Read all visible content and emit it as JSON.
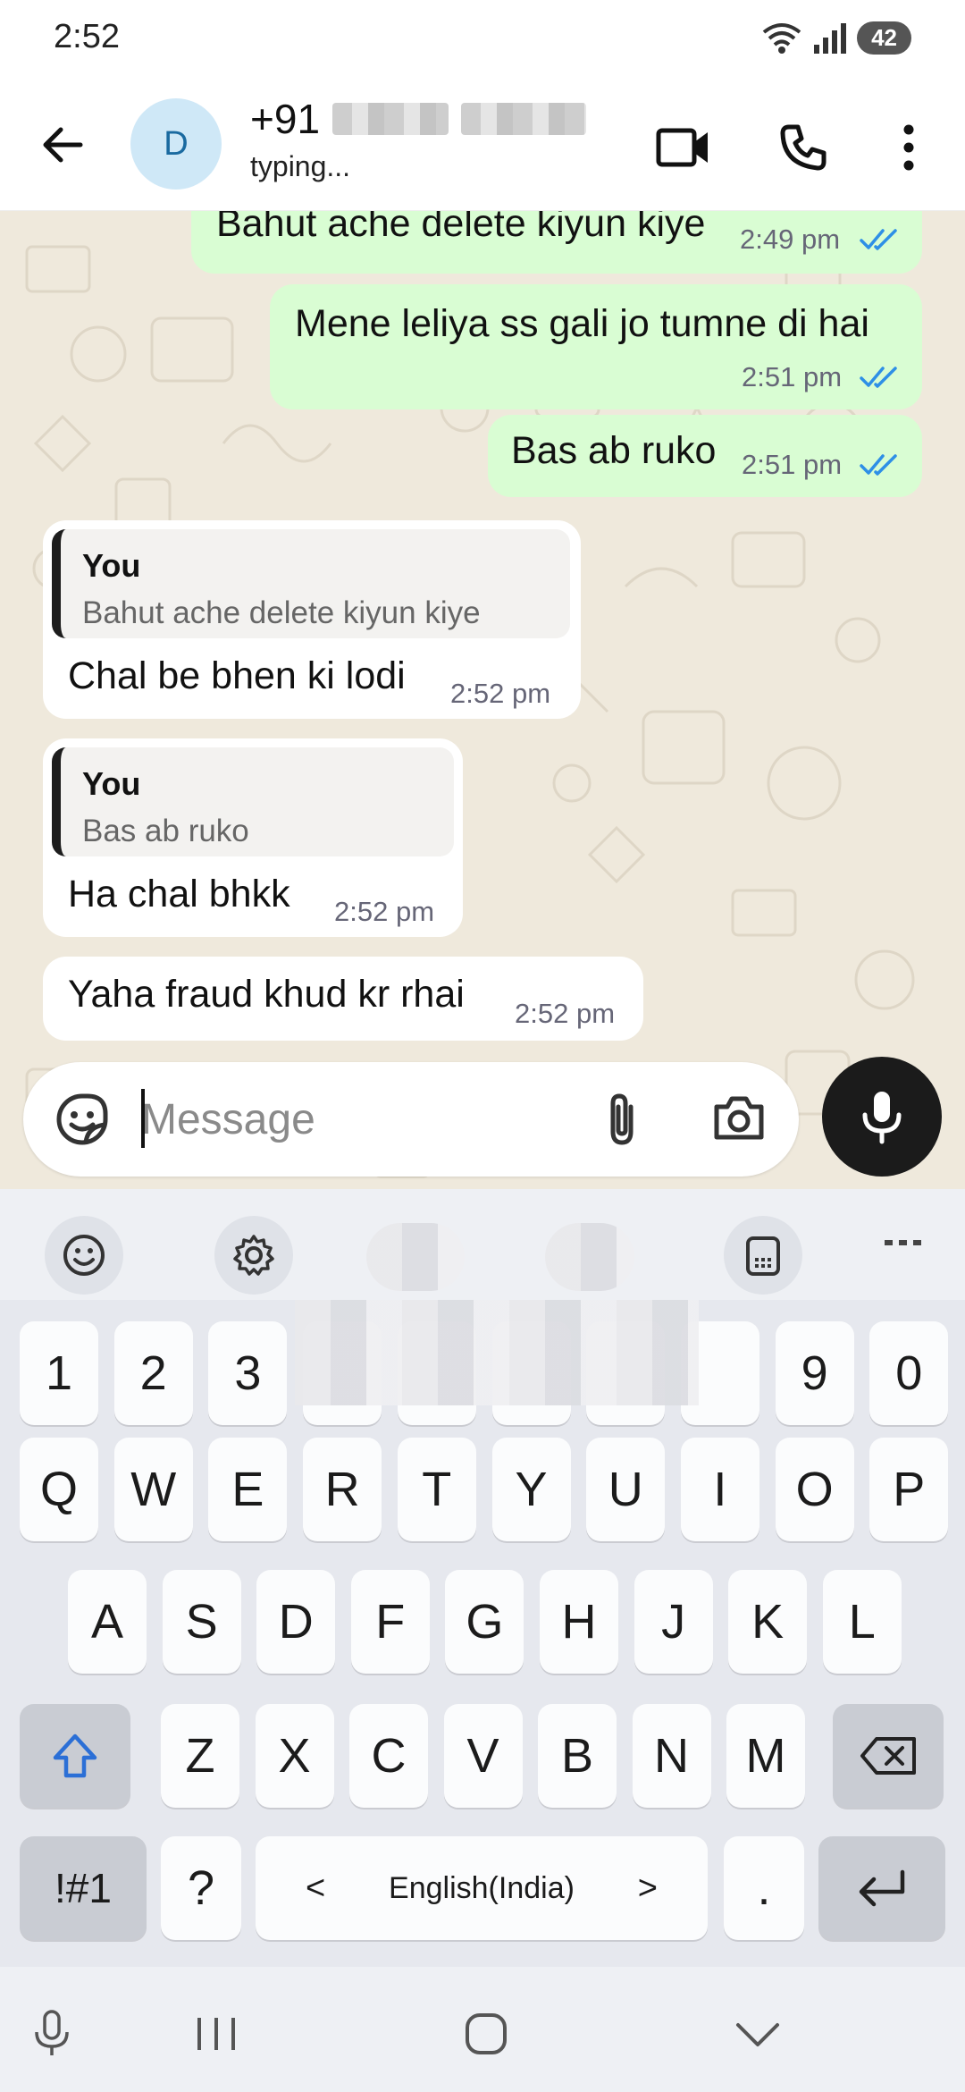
{
  "status_bar": {
    "time": "2:52",
    "battery": "42"
  },
  "header": {
    "avatar_letter": "D",
    "contact_prefix": "+91",
    "contact_status": "typing..."
  },
  "messages": [
    {
      "direction": "out",
      "text": "Bahut ache delete kiyun kiye",
      "time": "2:49 pm",
      "status": "read"
    },
    {
      "direction": "out",
      "text": "Mene leliya ss gali jo tumne di hai",
      "time": "2:51 pm",
      "status": "read"
    },
    {
      "direction": "out",
      "text": "Bas ab ruko",
      "time": "2:51 pm",
      "status": "read"
    },
    {
      "direction": "in",
      "quote_author": "You",
      "quote_text": "Bahut ache delete kiyun kiye",
      "text": "Chal be bhen ki lodi",
      "time": "2:52 pm"
    },
    {
      "direction": "in",
      "quote_author": "You",
      "quote_text": "Bas ab ruko",
      "text": "Ha chal bhkk",
      "time": "2:52 pm"
    },
    {
      "direction": "in",
      "text": "Yaha fraud khud kr rhai",
      "time": "2:52 pm"
    }
  ],
  "composer": {
    "placeholder": "Message"
  },
  "keyboard": {
    "number_row": [
      "1",
      "2",
      "3",
      "",
      "",
      "",
      "",
      "",
      "9",
      "0"
    ],
    "row1": [
      "Q",
      "W",
      "E",
      "R",
      "T",
      "Y",
      "U",
      "I",
      "O",
      "P"
    ],
    "row2": [
      "A",
      "S",
      "D",
      "F",
      "G",
      "H",
      "J",
      "K",
      "L"
    ],
    "row3": [
      "Z",
      "X",
      "C",
      "V",
      "B",
      "N",
      "M"
    ],
    "symbols_label": "!#1",
    "question_label": "?",
    "language_label": "English(India)",
    "period_label": "."
  },
  "colors": {
    "outgoing_bubble": "#d9fdd3",
    "incoming_bubble": "#ffffff",
    "chat_background": "#efe9dc",
    "read_tick": "#2e8fe6",
    "mic_button": "#1b1b1b"
  },
  "icons": [
    "back-arrow-icon",
    "video-call-icon",
    "voice-call-icon",
    "more-vert-icon",
    "sticker-icon",
    "attach-icon",
    "camera-icon",
    "mic-icon",
    "emoji-icon",
    "settings-icon",
    "clipboard-icon",
    "shift-icon",
    "backspace-icon",
    "enter-icon"
  ]
}
